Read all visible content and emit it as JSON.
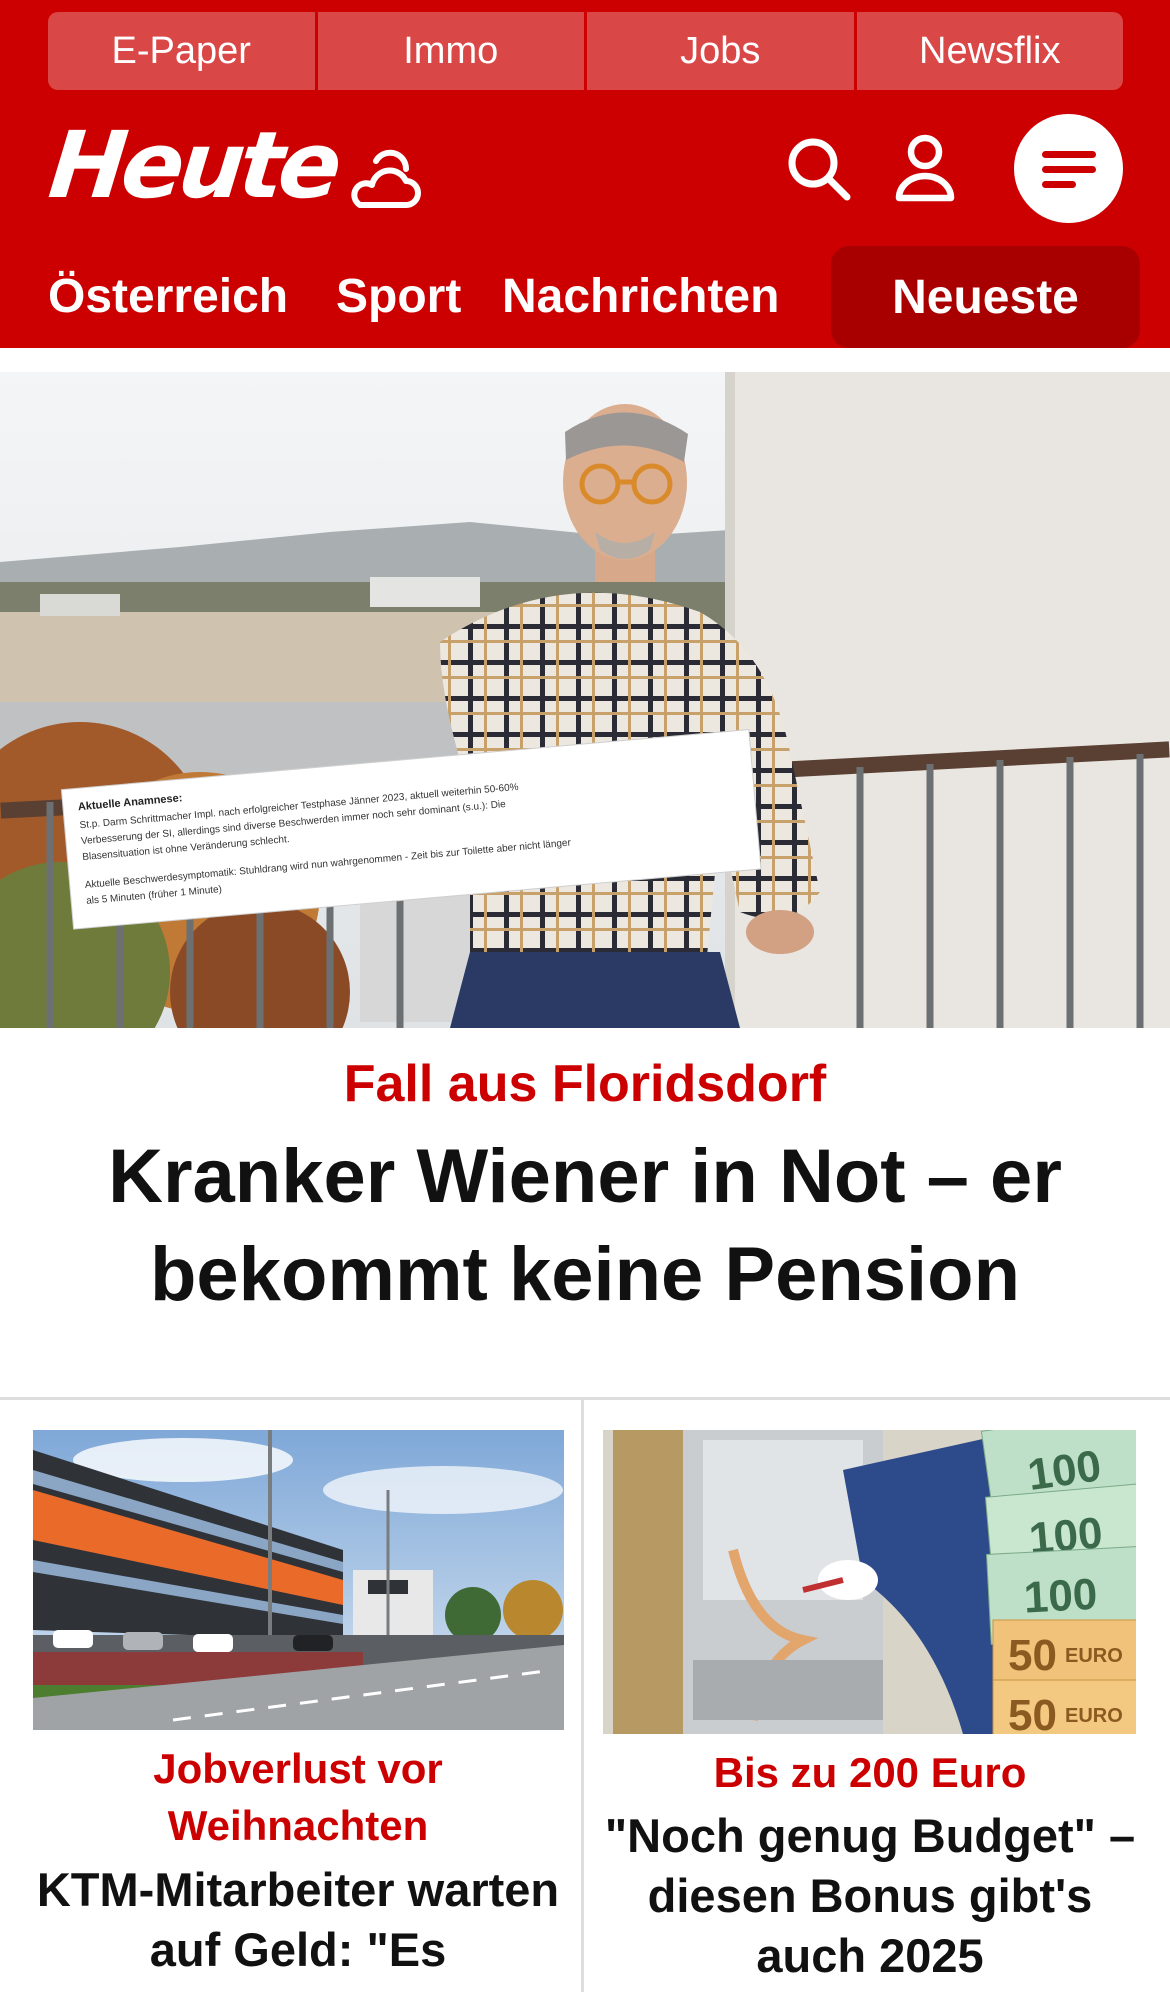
{
  "topnav": {
    "items": [
      "E-Paper",
      "Immo",
      "Jobs",
      "Newsflix"
    ]
  },
  "header": {
    "logo": "Heute",
    "icons": [
      "weather-cloud-icon",
      "search-icon",
      "user-icon",
      "menu-icon"
    ]
  },
  "secnav": {
    "items": [
      "Österreich",
      "Sport",
      "Nachrichten"
    ],
    "active": "Neueste"
  },
  "hero": {
    "kicker": "Fall aus Floridsdorf",
    "title": "Kranker Wiener in Not – er bekommt keine Pension",
    "document_lines": [
      "Aktuelle Anamnese:",
      "St.p. Darm Schrittmacher Impl. nach erfolgreicher Testphase Jänner 2023, aktuell weiterhin 50-60%",
      "Verbesserung der SI, allerdings sind diverse Beschwerden immer noch sehr dominant (s.u.): Die",
      "Blasensituation ist ohne Veränderung schlecht.",
      "Aktuelle Beschwerdesymptomatik: Stuhldrang wird nun wahrgenommen - Zeit bis zur Toilette aber nicht länger",
      "als 5 Minuten (früher 1 Minute)"
    ]
  },
  "cards": [
    {
      "kicker": "Jobverlust vor Weihnachten",
      "title": "KTM-Mitarbeiter warten auf Geld: \"Es"
    },
    {
      "kicker": "Bis zu 200 Euro",
      "title": "\"Noch genug Budget\" – diesen Bonus gibt's auch 2025",
      "banknotes": [
        "100",
        "100",
        "100",
        "50",
        "50"
      ],
      "currency": "EURO"
    }
  ],
  "colors": {
    "brand_red": "#cc0000",
    "dark_red": "#a80000",
    "pill_red": "#da4747"
  }
}
